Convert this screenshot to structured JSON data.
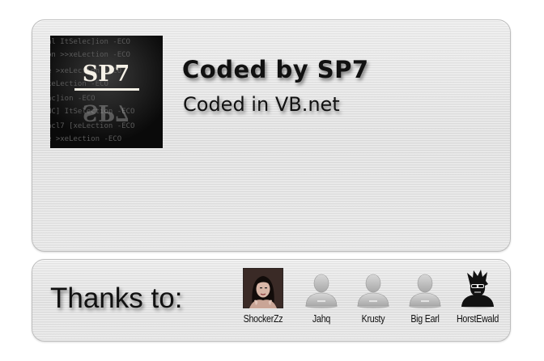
{
  "about": {
    "logo_text": "SP7",
    "logo_background_text": [
      "al ItSelec]ion -ECO",
      "on >>xeLection -ECO",
      "e >xeLection -ECO",
      "xeLection -ECO",
      "ac]ion -ECO",
      "NC] ItSelection -ECO",
      "acl7 [xeLection -ECO",
      "e >xeLection -ECO"
    ],
    "title": "Coded by SP7",
    "subtitle": "Coded in VB.net"
  },
  "thanks": {
    "label": "Thanks to:",
    "contributors": [
      {
        "name": "ShockerZz",
        "avatar": "photo-avatar-icon"
      },
      {
        "name": "Jahq",
        "avatar": "default-user-icon"
      },
      {
        "name": "Krusty",
        "avatar": "default-user-icon"
      },
      {
        "name": "Big Earl",
        "avatar": "default-user-icon"
      },
      {
        "name": "HorstEwald",
        "avatar": "silhouette-sunglasses-icon"
      }
    ]
  },
  "colors": {
    "panel": "#e6e6e6",
    "panel_border": "#bdbdbd",
    "text": "#111111",
    "logo_bg": "#0c0c0c"
  }
}
